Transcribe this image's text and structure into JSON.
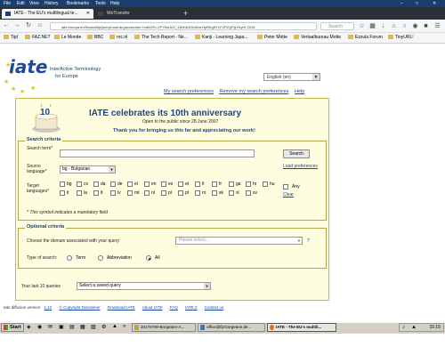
{
  "menu": [
    "File",
    "Edit",
    "View",
    "History",
    "Bookmarks",
    "Tools",
    "Help"
  ],
  "tabs": [
    {
      "label": "IATE - The EU's multilingual te...",
      "active": true
    },
    {
      "label": "WeTransfer",
      "active": false
    }
  ],
  "newtab": "+",
  "url": "iate.europa.eu/SearchByQueryLoad.do;jsessionid=Yzd63Yh-XFYkluJuV_13HhA3Ob52wYfpRKg5YLFZPZQPgYKyH!-2016",
  "search_placeholder": "Search",
  "bookmarks": [
    "Tijd",
    "FAZ.NET",
    "Le Monde",
    "BBC",
    "nrc.nl",
    "The Tech Report - Ne...",
    "Kanji - Learning Japa...",
    "Peter Motte",
    "Vertaalbureau Motte",
    "Ezzula Forum",
    "TinyURL!"
  ],
  "logo": {
    "word": "iate",
    "line1": "InterActive Terminology",
    "line2": "for Europe"
  },
  "language_select": "English (en)",
  "top_links": [
    "My search preferences",
    "Remove my search preferences",
    "Help"
  ],
  "announcement": {
    "title": "IATE celebrates its 10th anniversary",
    "subtitle": "Open to the public since 28 June 2007",
    "thanks": "Thank you for bringing us this far and appreciating our work!"
  },
  "search": {
    "legend": "Search criteria",
    "term_label": "Search term*",
    "term_value": "",
    "search_button": "Search",
    "source_label": "Source language*",
    "source_value": "bg - Bulgarian",
    "load_prefs": "Load preferences",
    "target_label": "Target languages*",
    "target_row1": [
      "bg",
      "cs",
      "da",
      "de",
      "el",
      "en",
      "es",
      "et",
      "fi",
      "fr",
      "ga",
      "hr",
      "hu"
    ],
    "target_row2": [
      "it",
      "la",
      "lt",
      "lv",
      "mt",
      "nl",
      "pl",
      "pt",
      "ro",
      "sk",
      "sl",
      "sv"
    ],
    "any_label": "Any",
    "clear_label": "Clear",
    "mandatory_note": "* This symbol indicates a mandatory field"
  },
  "optional": {
    "legend": "Optional criteria",
    "domain_label": "Choose the domain associated with your query",
    "domain_placeholder": "Please select...",
    "help_mark": "?",
    "type_label": "Type of search:",
    "type_options": [
      "Term",
      "Abbreviation",
      "All"
    ],
    "type_selected": "All",
    "last_label": "Your last 10 queries",
    "last_value": "Select a saved query"
  },
  "footer": {
    "version_text": "Iate diffusion version",
    "version": "1.12",
    "links": [
      "© Copyright Disclaimer",
      "Download IATE",
      "About IATE",
      "FAQ",
      "IATE 2",
      "Contact us"
    ]
  },
  "taskbar": {
    "start": "Start",
    "tasks": [
      "20170700-Borgeann-A...",
      "office@fijt-borgeann.de...",
      "IATE - The EU's multili..."
    ],
    "clock": "15:15"
  }
}
